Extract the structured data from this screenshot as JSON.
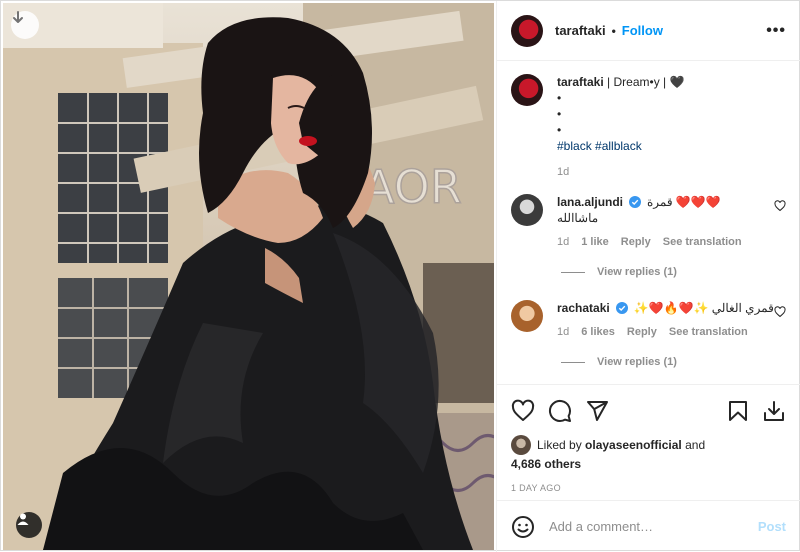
{
  "post": {
    "username": "taraftaki",
    "follow_label": "Follow",
    "separator": "•",
    "more_label": "•••"
  },
  "caption": {
    "username": "taraftaki",
    "text": "| Dream•y | 🖤",
    "bullets": [
      "•",
      "•",
      "•"
    ],
    "hashtags": [
      "#black",
      "#allblack"
    ],
    "time": "1d"
  },
  "comments": [
    {
      "username": "lana.aljundi",
      "verified": true,
      "text_line1": "❤️❤️❤️ قمرة",
      "text_line2": "ماشاالله",
      "time": "1d",
      "likes": "1 like",
      "reply_label": "Reply",
      "translate_label": "See translation",
      "view_replies": "View replies (1)"
    },
    {
      "username": "rachataki",
      "verified": true,
      "text_line1": "قمري الغالي ✨❤️🔥❤️✨",
      "time": "1d",
      "likes": "6 likes",
      "reply_label": "Reply",
      "translate_label": "See translation",
      "view_replies": "View replies (1)"
    }
  ],
  "likes": {
    "prefix": "Liked by",
    "user": "olayaseenofficial",
    "and": "and",
    "others": "4,686 others"
  },
  "age": "1 DAY AGO",
  "add_comment": {
    "placeholder": "Add a comment…",
    "post_label": "Post"
  },
  "icons": {
    "download": "download-icon",
    "tag": "user-tag-icon",
    "like": "heart-icon",
    "comment": "comment-icon",
    "share": "send-icon",
    "save": "bookmark-icon",
    "save_to_device": "download-tray-icon",
    "emoji": "emoji-icon"
  },
  "colors": {
    "accent": "#0095f6",
    "heart_red": "#ed4956",
    "verified": "#3897f0",
    "muted": "#8e8e8e",
    "hashtag": "#00376b"
  }
}
